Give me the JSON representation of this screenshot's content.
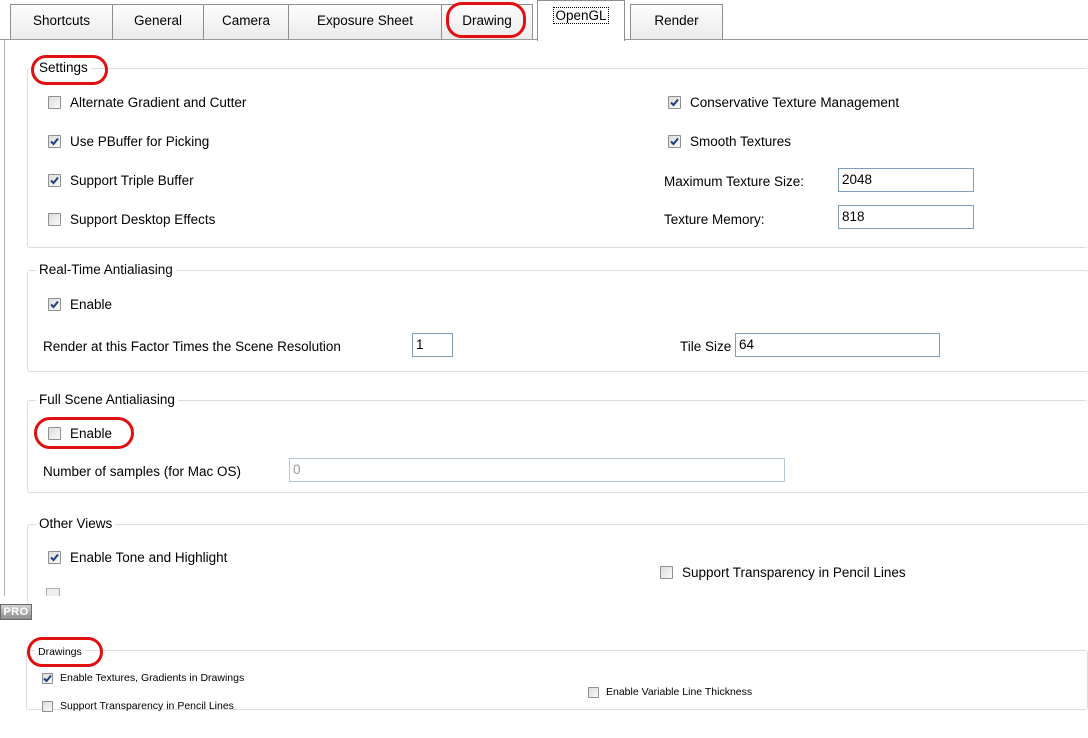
{
  "tabs": [
    {
      "label": "Shortcuts",
      "active": false
    },
    {
      "label": "General",
      "active": false
    },
    {
      "label": "Camera",
      "active": false
    },
    {
      "label": "Exposure Sheet",
      "active": false
    },
    {
      "label": "Drawing",
      "active": false
    },
    {
      "label": "OpenGL",
      "active": true
    },
    {
      "label": "Render",
      "active": false
    }
  ],
  "settings": {
    "title": "Settings",
    "alternate_gradient": {
      "label": "Alternate Gradient and Cutter",
      "checked": false
    },
    "use_pbuffer": {
      "label": "Use PBuffer for Picking",
      "checked": true
    },
    "triple_buffer": {
      "label": "Support Triple Buffer",
      "checked": true
    },
    "desktop_effects": {
      "label": "Support Desktop Effects",
      "checked": false
    },
    "conservative_texture": {
      "label": "Conservative Texture Management",
      "checked": true
    },
    "smooth_textures": {
      "label": "Smooth Textures",
      "checked": true
    },
    "max_texture_size": {
      "label": "Maximum Texture Size:",
      "value": "2048"
    },
    "texture_memory": {
      "label": "Texture Memory:",
      "value": "818"
    }
  },
  "realtime_aa": {
    "title": "Real-Time Antialiasing",
    "enable": {
      "label": "Enable",
      "checked": true
    },
    "factor": {
      "label": "Render at this Factor Times the Scene Resolution",
      "value": "1"
    },
    "tile_size": {
      "label": "Tile Size",
      "value": "64"
    }
  },
  "fullscene_aa": {
    "title": "Full Scene Antialiasing",
    "enable": {
      "label": "Enable",
      "checked": false
    },
    "samples": {
      "label": "Number of samples (for Mac OS)",
      "value": "0"
    }
  },
  "other_views": {
    "title": "Other Views",
    "tone_highlight": {
      "label": "Enable Tone and Highlight",
      "checked": true
    },
    "pencil_transparency": {
      "label": "Support Transparency in Pencil Lines",
      "checked": false
    }
  },
  "pro_badge": "PRO",
  "drawings": {
    "title": "Drawings",
    "textures_gradients": {
      "label": "Enable Textures, Gradients in Drawings",
      "checked": true
    },
    "pencil_transparency": {
      "label": "Support Transparency in Pencil Lines",
      "checked": false
    },
    "variable_thickness": {
      "label": "Enable Variable Line Thickness",
      "checked": false
    }
  },
  "colors": {
    "annotation": "#e01010",
    "check": "#1f3f7a",
    "field_border": "#7f9db9"
  }
}
